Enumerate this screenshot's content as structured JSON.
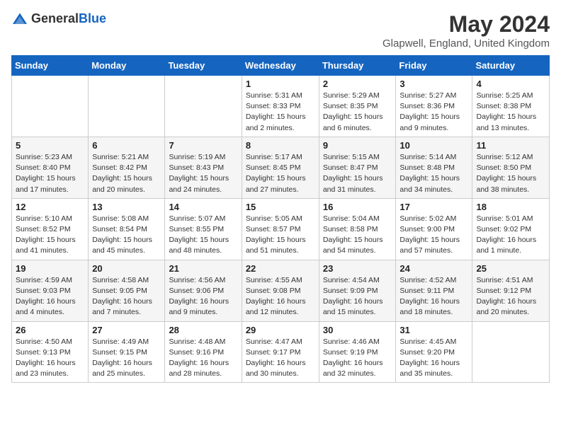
{
  "header": {
    "logo_general": "General",
    "logo_blue": "Blue",
    "month_year": "May 2024",
    "location": "Glapwell, England, United Kingdom"
  },
  "weekdays": [
    "Sunday",
    "Monday",
    "Tuesday",
    "Wednesday",
    "Thursday",
    "Friday",
    "Saturday"
  ],
  "weeks": [
    [
      {
        "day": "",
        "info": ""
      },
      {
        "day": "",
        "info": ""
      },
      {
        "day": "",
        "info": ""
      },
      {
        "day": "1",
        "info": "Sunrise: 5:31 AM\nSunset: 8:33 PM\nDaylight: 15 hours\nand 2 minutes."
      },
      {
        "day": "2",
        "info": "Sunrise: 5:29 AM\nSunset: 8:35 PM\nDaylight: 15 hours\nand 6 minutes."
      },
      {
        "day": "3",
        "info": "Sunrise: 5:27 AM\nSunset: 8:36 PM\nDaylight: 15 hours\nand 9 minutes."
      },
      {
        "day": "4",
        "info": "Sunrise: 5:25 AM\nSunset: 8:38 PM\nDaylight: 15 hours\nand 13 minutes."
      }
    ],
    [
      {
        "day": "5",
        "info": "Sunrise: 5:23 AM\nSunset: 8:40 PM\nDaylight: 15 hours\nand 17 minutes."
      },
      {
        "day": "6",
        "info": "Sunrise: 5:21 AM\nSunset: 8:42 PM\nDaylight: 15 hours\nand 20 minutes."
      },
      {
        "day": "7",
        "info": "Sunrise: 5:19 AM\nSunset: 8:43 PM\nDaylight: 15 hours\nand 24 minutes."
      },
      {
        "day": "8",
        "info": "Sunrise: 5:17 AM\nSunset: 8:45 PM\nDaylight: 15 hours\nand 27 minutes."
      },
      {
        "day": "9",
        "info": "Sunrise: 5:15 AM\nSunset: 8:47 PM\nDaylight: 15 hours\nand 31 minutes."
      },
      {
        "day": "10",
        "info": "Sunrise: 5:14 AM\nSunset: 8:48 PM\nDaylight: 15 hours\nand 34 minutes."
      },
      {
        "day": "11",
        "info": "Sunrise: 5:12 AM\nSunset: 8:50 PM\nDaylight: 15 hours\nand 38 minutes."
      }
    ],
    [
      {
        "day": "12",
        "info": "Sunrise: 5:10 AM\nSunset: 8:52 PM\nDaylight: 15 hours\nand 41 minutes."
      },
      {
        "day": "13",
        "info": "Sunrise: 5:08 AM\nSunset: 8:54 PM\nDaylight: 15 hours\nand 45 minutes."
      },
      {
        "day": "14",
        "info": "Sunrise: 5:07 AM\nSunset: 8:55 PM\nDaylight: 15 hours\nand 48 minutes."
      },
      {
        "day": "15",
        "info": "Sunrise: 5:05 AM\nSunset: 8:57 PM\nDaylight: 15 hours\nand 51 minutes."
      },
      {
        "day": "16",
        "info": "Sunrise: 5:04 AM\nSunset: 8:58 PM\nDaylight: 15 hours\nand 54 minutes."
      },
      {
        "day": "17",
        "info": "Sunrise: 5:02 AM\nSunset: 9:00 PM\nDaylight: 15 hours\nand 57 minutes."
      },
      {
        "day": "18",
        "info": "Sunrise: 5:01 AM\nSunset: 9:02 PM\nDaylight: 16 hours\nand 1 minute."
      }
    ],
    [
      {
        "day": "19",
        "info": "Sunrise: 4:59 AM\nSunset: 9:03 PM\nDaylight: 16 hours\nand 4 minutes."
      },
      {
        "day": "20",
        "info": "Sunrise: 4:58 AM\nSunset: 9:05 PM\nDaylight: 16 hours\nand 7 minutes."
      },
      {
        "day": "21",
        "info": "Sunrise: 4:56 AM\nSunset: 9:06 PM\nDaylight: 16 hours\nand 9 minutes."
      },
      {
        "day": "22",
        "info": "Sunrise: 4:55 AM\nSunset: 9:08 PM\nDaylight: 16 hours\nand 12 minutes."
      },
      {
        "day": "23",
        "info": "Sunrise: 4:54 AM\nSunset: 9:09 PM\nDaylight: 16 hours\nand 15 minutes."
      },
      {
        "day": "24",
        "info": "Sunrise: 4:52 AM\nSunset: 9:11 PM\nDaylight: 16 hours\nand 18 minutes."
      },
      {
        "day": "25",
        "info": "Sunrise: 4:51 AM\nSunset: 9:12 PM\nDaylight: 16 hours\nand 20 minutes."
      }
    ],
    [
      {
        "day": "26",
        "info": "Sunrise: 4:50 AM\nSunset: 9:13 PM\nDaylight: 16 hours\nand 23 minutes."
      },
      {
        "day": "27",
        "info": "Sunrise: 4:49 AM\nSunset: 9:15 PM\nDaylight: 16 hours\nand 25 minutes."
      },
      {
        "day": "28",
        "info": "Sunrise: 4:48 AM\nSunset: 9:16 PM\nDaylight: 16 hours\nand 28 minutes."
      },
      {
        "day": "29",
        "info": "Sunrise: 4:47 AM\nSunset: 9:17 PM\nDaylight: 16 hours\nand 30 minutes."
      },
      {
        "day": "30",
        "info": "Sunrise: 4:46 AM\nSunset: 9:19 PM\nDaylight: 16 hours\nand 32 minutes."
      },
      {
        "day": "31",
        "info": "Sunrise: 4:45 AM\nSunset: 9:20 PM\nDaylight: 16 hours\nand 35 minutes."
      },
      {
        "day": "",
        "info": ""
      }
    ]
  ]
}
